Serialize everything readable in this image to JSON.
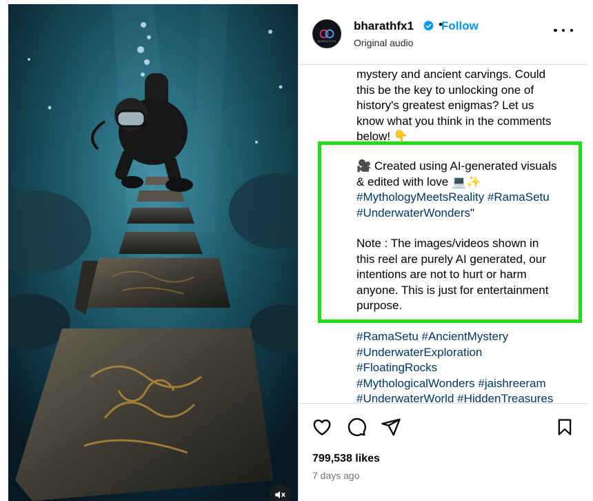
{
  "header": {
    "username": "bharathfx1",
    "separator": "•",
    "follow_label": "Follow",
    "audio": "Original audio",
    "avatar_text": "BHARATH FX"
  },
  "caption": {
    "lines_before": [
      "mystery and ancient carvings. Could",
      "this be the key to unlocking one of",
      "history's greatest enigmas? Let us",
      "know what you think in the comments",
      "below! 👇"
    ],
    "created_line_1": "🎥 Created using AI-generated visuals",
    "created_line_2": "& edited with love 💻✨",
    "hashtag_line_1_a": "#MythologyMeetsReality",
    "hashtag_line_1_b": "#RamaSetu",
    "hashtag_line_2_a": "#UnderwaterWonders",
    "hashtag_line_2_b": "\"",
    "note_lines": [
      "Note : The images/videos shown in",
      "this reel are purely AI generated, our",
      "intentions are not to hurt or harm",
      "anyone. This is just for entertainment",
      "purpose."
    ],
    "tags_after": [
      [
        "#RamaSetu",
        "#AncientMystery"
      ],
      [
        "#UnderwaterExploration"
      ],
      [
        "#FloatingRocks"
      ],
      [
        "#MythologicalWonders",
        "#jaishreeram"
      ],
      [
        "#UnderwaterWorld",
        "#HiddenTreasures"
      ]
    ]
  },
  "footer": {
    "likes": "799,538 likes",
    "time_ago": "7 days ago"
  },
  "icons": {
    "like": "heart-icon",
    "comment": "comment-icon",
    "share": "share-icon",
    "save": "bookmark-icon",
    "mute": "speaker-muted-icon",
    "more": "more-options-icon",
    "verified": "verified-badge-icon"
  },
  "colors": {
    "follow": "#0095f6",
    "hashtag": "#00376b",
    "highlight": "#22dd11",
    "secondary_text": "#737373",
    "verified": "#0095f6"
  }
}
